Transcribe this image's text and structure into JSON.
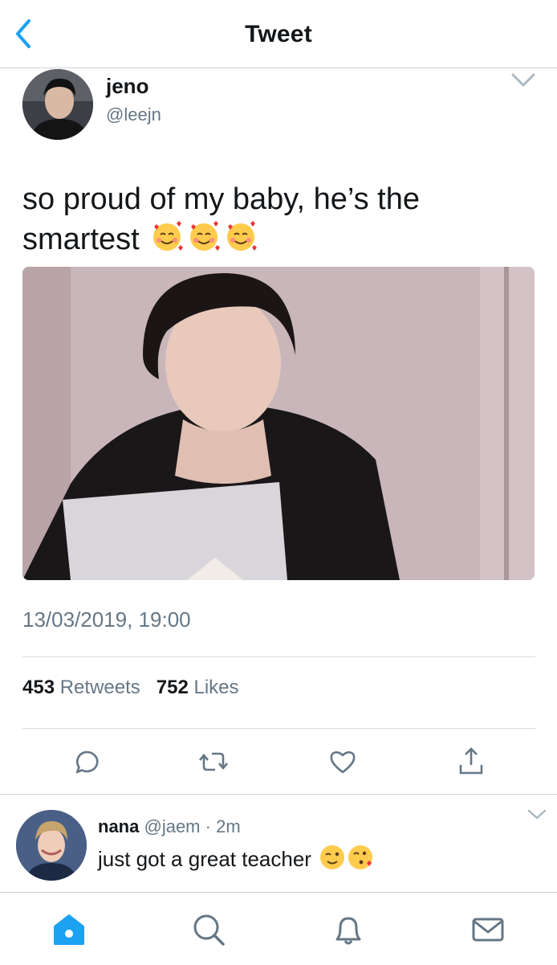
{
  "header": {
    "title": "Tweet",
    "back_icon": "chevron-left-icon",
    "accent": "#1da1f2"
  },
  "tweet": {
    "author_name": "jeno",
    "author_handle": "@leejn",
    "text": "so proud of my baby, he’s the smartest",
    "text_emojis": [
      "smiling-face-with-hearts",
      "smiling-face-with-hearts",
      "smiling-face-with-hearts"
    ],
    "timestamp": "13/03/2019, 19:00",
    "retweets_count": "453",
    "retweets_label": "Retweets",
    "likes_count": "752",
    "likes_label": "Likes",
    "actions": [
      "reply-icon",
      "retweet-icon",
      "like-icon",
      "share-icon"
    ]
  },
  "reply": {
    "author_name": "nana",
    "author_handle": "@jaem",
    "separator": "·",
    "time": "2m",
    "text": "just got a great teacher",
    "text_emojis": [
      "winking-face",
      "face-blowing-kiss"
    ]
  },
  "tabbar": {
    "tabs": [
      "home-icon",
      "search-icon",
      "notifications-icon",
      "messages-icon"
    ],
    "active": "home-icon"
  },
  "colors": {
    "text_primary": "#14171a",
    "text_secondary": "#657786",
    "icon_gray": "#657786",
    "divider": "#cfd3d6"
  }
}
